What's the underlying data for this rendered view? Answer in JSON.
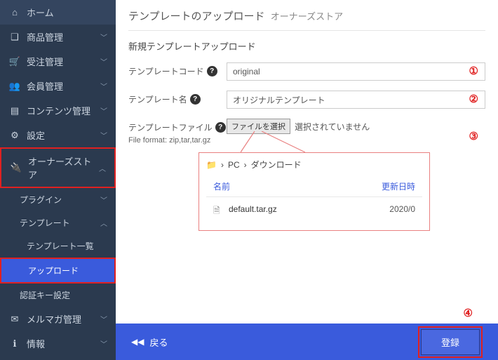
{
  "sidebar": {
    "home": "ホーム",
    "product": "商品管理",
    "order": "受注管理",
    "member": "会員管理",
    "content": "コンテンツ管理",
    "settings": "設定",
    "owners": "オーナーズストア",
    "plugin": "プラグイン",
    "template": "テンプレート",
    "template_list": "テンプレート一覧",
    "upload": "アップロード",
    "auth_key": "認証キー設定",
    "mailmag": "メルマガ管理",
    "info": "情報"
  },
  "page": {
    "title": "テンプレートのアップロード",
    "subtitle": "オーナーズストア",
    "panel_title": "新規テンプレートアップロード"
  },
  "form": {
    "code_label": "テンプレートコード",
    "code_value": "original",
    "name_label": "テンプレート名",
    "name_value": "オリジナルテンプレート",
    "file_label": "テンプレートファイル",
    "file_button": "ファイルを選択",
    "file_none": "選択されていません",
    "file_format": "File format: zip,tar,tar.gz"
  },
  "dialog": {
    "pc": "PC",
    "downloads": "ダウンロード",
    "col_name": "名前",
    "col_date": "更新日時",
    "file_name": "default.tar.gz",
    "file_date": "2020/0"
  },
  "annotations": {
    "a1": "①",
    "a2": "②",
    "a3": "③",
    "a4": "④"
  },
  "footer": {
    "back": "戻る",
    "submit": "登録"
  }
}
